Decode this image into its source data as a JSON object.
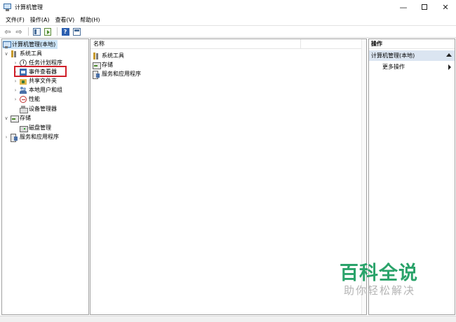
{
  "window": {
    "title": "计算机管理",
    "controls": {
      "minimize": "—",
      "maximize": "",
      "close": "✕"
    }
  },
  "menubar": {
    "items": [
      {
        "label": "文件(F)"
      },
      {
        "label": "操作(A)"
      },
      {
        "label": "查看(V)"
      },
      {
        "label": "帮助(H)"
      }
    ]
  },
  "toolbar": {
    "back_icon": "arrow-left-icon",
    "forward_icon": "arrow-right-icon",
    "back_glyph": "⇦",
    "forward_glyph": "⇨",
    "help_glyph": "?"
  },
  "tree": {
    "items": [
      {
        "label": "计算机管理(本地)",
        "icon": "computer-icon",
        "level": 0,
        "expanded": true,
        "selected": true
      },
      {
        "label": "系统工具",
        "icon": "tools-icon",
        "level": 1,
        "expanded": true,
        "chevron": "∨"
      },
      {
        "label": "任务计划程序",
        "icon": "clock-icon",
        "level": 2,
        "chevron": "›"
      },
      {
        "label": "事件查看器",
        "icon": "event-viewer-icon",
        "level": 2,
        "chevron": "›"
      },
      {
        "label": "共享文件夹",
        "icon": "shared-folder-icon",
        "level": 2,
        "chevron": "›"
      },
      {
        "label": "本地用户和组",
        "icon": "users-icon",
        "level": 2,
        "chevron": "›"
      },
      {
        "label": "性能",
        "icon": "performance-icon",
        "level": 2,
        "chevron": "›"
      },
      {
        "label": "设备管理器",
        "icon": "device-manager-icon",
        "level": 2,
        "highlighted": true
      },
      {
        "label": "存储",
        "icon": "storage-icon",
        "level": 1,
        "expanded": true,
        "chevron": "∨"
      },
      {
        "label": "磁盘管理",
        "icon": "disk-icon",
        "level": 2
      },
      {
        "label": "服务和应用程序",
        "icon": "services-icon",
        "level": 1,
        "chevron": "›"
      }
    ]
  },
  "center": {
    "column_header": "名称",
    "rows": [
      {
        "label": "系统工具",
        "icon": "tools-icon"
      },
      {
        "label": "存储",
        "icon": "storage-icon"
      },
      {
        "label": "服务和应用程序",
        "icon": "services-icon"
      }
    ]
  },
  "actions": {
    "header": "操作",
    "group_title": "计算机管理(本地)",
    "more_label": "更多操作"
  },
  "watermark": {
    "line1": "百科全说",
    "line2": "助你轻松解决"
  },
  "colors": {
    "highlight_box": "#d0202a",
    "selected_bg": "#cce4f7",
    "actions_group_bg": "#dbe5f1",
    "watermark_green": "#2aa36a"
  }
}
